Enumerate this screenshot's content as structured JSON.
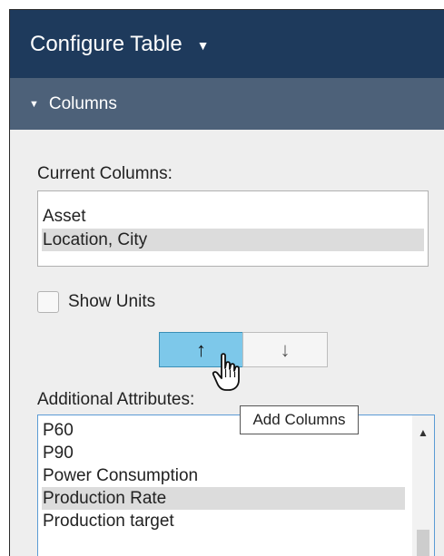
{
  "header": {
    "title": "Configure Table",
    "caret": "▼"
  },
  "section": {
    "label": "Columns",
    "tri": "▼"
  },
  "current_columns": {
    "label": "Current Columns:",
    "items": [
      {
        "label": "Asset",
        "selected": false
      },
      {
        "label": "Location, City",
        "selected": true
      }
    ]
  },
  "show_units": {
    "label": "Show Units",
    "checked": false
  },
  "buttons": {
    "up": "↑",
    "down": "↓"
  },
  "tooltip": "Add Columns",
  "additional_attributes": {
    "label": "Additional Attributes:",
    "items": [
      {
        "label": "P60",
        "selected": false
      },
      {
        "label": "P90",
        "selected": false
      },
      {
        "label": "Power Consumption",
        "selected": false
      },
      {
        "label": "Production Rate",
        "selected": true
      },
      {
        "label": "Production target",
        "selected": false
      }
    ],
    "scroll_up": "▲"
  },
  "colors": {
    "header_bg": "#1e3a5c",
    "section_bg": "#4d6179",
    "accent": "#7dc8ea",
    "focus_border": "#5b9bd5"
  }
}
